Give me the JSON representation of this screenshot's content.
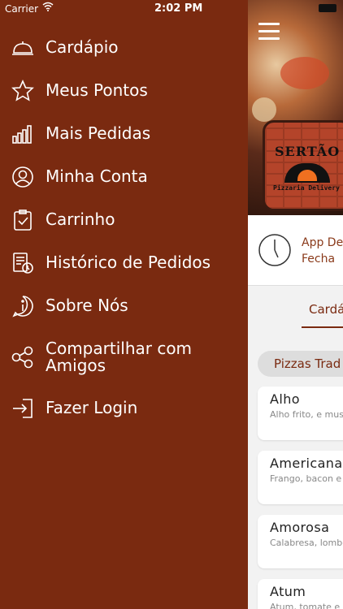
{
  "status_bar": {
    "carrier": "Carrier",
    "time": "2:02 PM"
  },
  "menu": {
    "items": [
      {
        "label": "Cardápio",
        "icon": "cloche-icon"
      },
      {
        "label": "Meus Pontos",
        "icon": "star-icon"
      },
      {
        "label": "Mais Pedidas",
        "icon": "bar-chart-icon"
      },
      {
        "label": "Minha Conta",
        "icon": "user-icon"
      },
      {
        "label": "Carrinho",
        "icon": "clipboard-check-icon"
      },
      {
        "label": "Histórico de Pedidos",
        "icon": "history-list-icon"
      },
      {
        "label": "Sobre Nós",
        "icon": "info-icon"
      },
      {
        "label": "Compartilhar com Amigos",
        "icon": "share-icon"
      },
      {
        "label": "Fazer Login",
        "icon": "login-icon"
      }
    ]
  },
  "main": {
    "logo_title": "SERTÃO",
    "logo_subtitle": "Pizzaria Delivery",
    "status_line1": "App De",
    "status_line2": "Fecha",
    "tab_label": "Cardá",
    "category_chip": "Pizzas Trad",
    "cards": [
      {
        "name": "Alho",
        "desc": "Alho frito, e muss"
      },
      {
        "name": "Americana",
        "desc": "Frango, bacon e p"
      },
      {
        "name": "Amorosa",
        "desc": "Calabresa, lombo"
      },
      {
        "name": "Atum",
        "desc": "Atum, tomate e c"
      }
    ]
  },
  "colors": {
    "drawer_bg": "#7a2a10",
    "accent": "#7a2a10"
  }
}
